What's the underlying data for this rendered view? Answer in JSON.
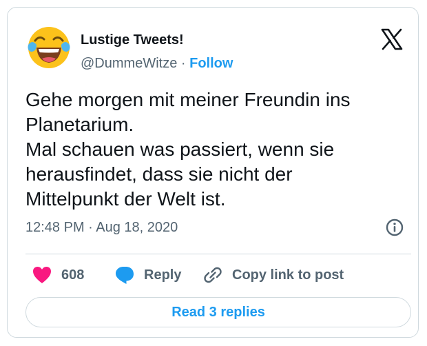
{
  "author": {
    "display_name": "Lustige Tweets!",
    "handle": "@DummeWitze",
    "separator": "·",
    "follow_label": "Follow",
    "avatar_icon": "face-with-tears-of-joy-emoji"
  },
  "tweet": {
    "lines": [
      "Gehe morgen mit meiner Freundin ins",
      "Planetarium.",
      "Mal schauen was passiert, wenn sie",
      "herausfindet, dass sie nicht der",
      "Mittelpunkt der Welt ist."
    ],
    "timestamp": "12:48 PM · Aug 18, 2020"
  },
  "actions": {
    "like_count": "608",
    "reply_label": "Reply",
    "copy_label": "Copy link to post"
  },
  "footer": {
    "read_replies_label": "Read 3 replies"
  },
  "icons": {
    "platform": "x-logo",
    "info": "info-icon",
    "like": "heart-icon",
    "reply": "speech-bubble-icon",
    "copy": "link-icon"
  },
  "colors": {
    "accent": "#1d9bf0",
    "like": "#f91880",
    "text": "#0f1419",
    "secondary": "#536471",
    "border": "#cfd9de"
  }
}
